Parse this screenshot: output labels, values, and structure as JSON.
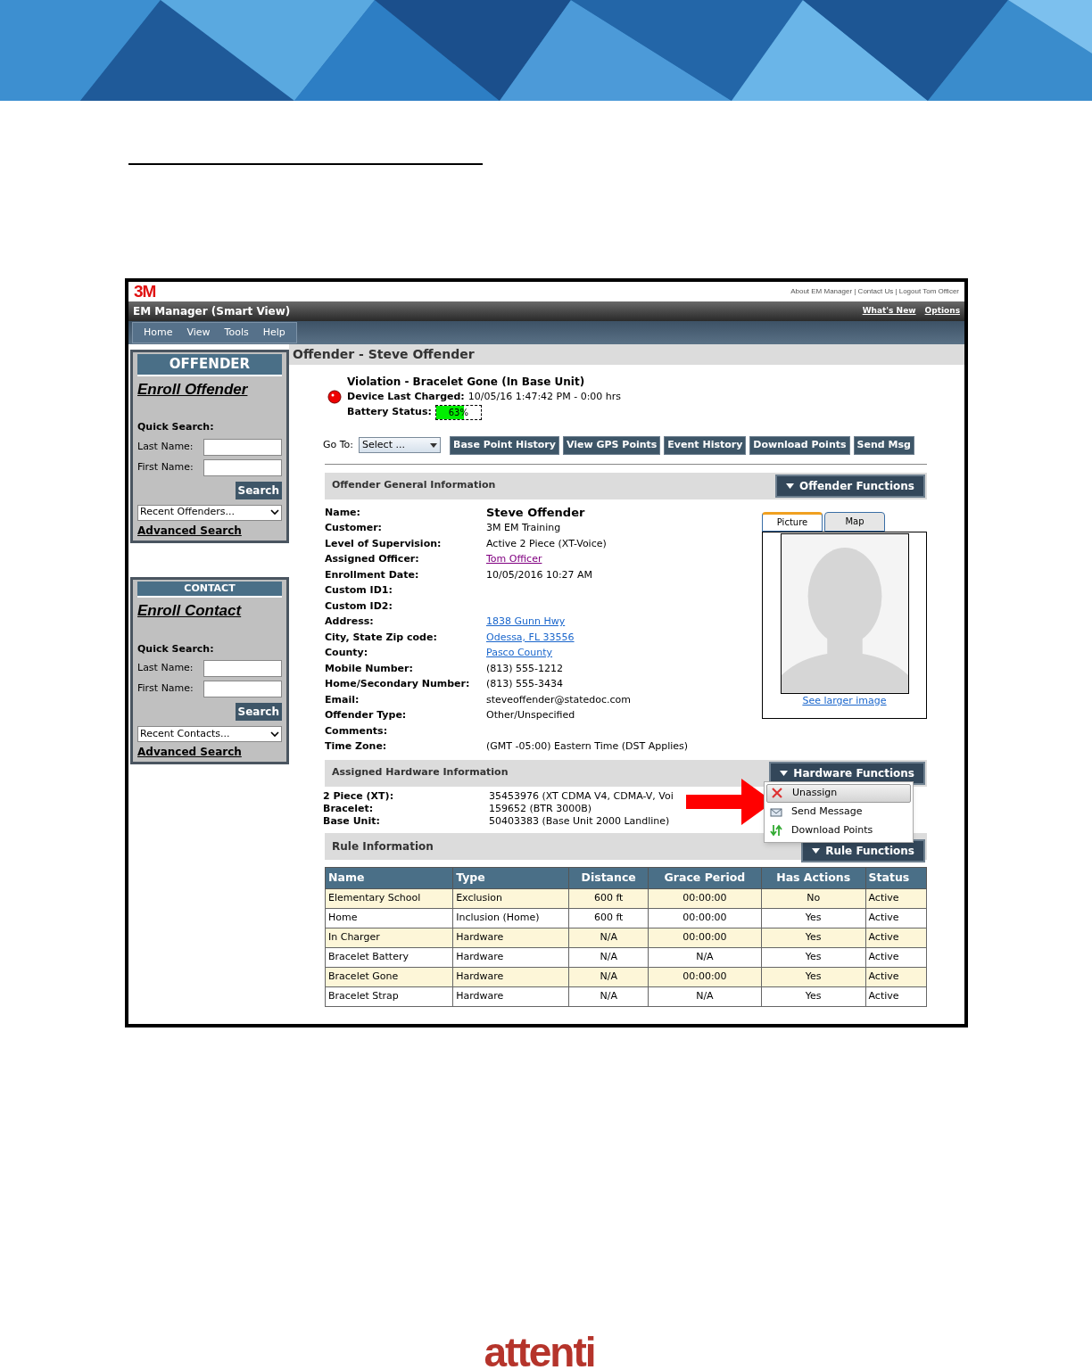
{
  "header": {
    "logo": "3M",
    "links": "About EM Manager | Contact Us | Logout Tom Officer"
  },
  "title_bar": {
    "title": "EM Manager (Smart View)",
    "links": [
      "What's New",
      "Options"
    ]
  },
  "menu": [
    "Home",
    "View",
    "Tools",
    "Help"
  ],
  "sidebar_panels": [
    {
      "title": "OFFENDER",
      "enroll": "Enroll Offender",
      "quick_search": "Quick Search:",
      "fields": [
        "Last Name:",
        "First Name:"
      ],
      "search_button": "Search",
      "recent": "Recent Offenders...",
      "advanced": "Advanced Search"
    },
    {
      "title": "CONTACT",
      "enroll": "Enroll Contact",
      "quick_search": "Quick Search:",
      "fields": [
        "Last Name:",
        "First Name:"
      ],
      "search_button": "Search",
      "recent": "Recent Contacts...",
      "advanced": "Advanced Search"
    }
  ],
  "page_title": "Offender - Steve Offender",
  "alert": {
    "violation": "Violation - Bracelet Gone (In Base Unit)",
    "charged_label": "Device Last Charged:",
    "charged_value": "10/05/16 1:47:42 PM - 0:00 hrs",
    "battery_label": "Battery Status:",
    "battery": {
      "level": 0.63,
      "reading": "63%"
    }
  },
  "goto": {
    "label": "Go To:",
    "select": "Select ..."
  },
  "actions": [
    "Base Point History",
    "View GPS Points",
    "Event History",
    "Download Points",
    "Send Msg"
  ],
  "general": {
    "title": "Offender General Information",
    "functions": "Offender Functions",
    "fields": [
      {
        "label": "Name:",
        "value": "Steve Offender",
        "kind": "heading"
      },
      {
        "label": "Customer:",
        "value": "3M EM Training",
        "kind": "text"
      },
      {
        "label": "Level of Supervision:",
        "value": "Active 2 Piece (XT-Voice)",
        "kind": "text"
      },
      {
        "label": "Assigned Officer:",
        "value": "Tom Officer",
        "kind": "visited"
      },
      {
        "label": "Enrollment Date:",
        "value": "10/05/2016 10:27 AM",
        "kind": "text"
      },
      {
        "label": "Custom ID1:"
      },
      {
        "label": "Custom ID2:"
      },
      {
        "label": "Address:",
        "value": "1838 Gunn Hwy",
        "kind": "link"
      },
      {
        "label": "City, State Zip code:",
        "value": "Odessa, FL 33556",
        "kind": "link"
      },
      {
        "label": "County:",
        "value": "Pasco County",
        "kind": "link"
      },
      {
        "label": "Mobile Number:",
        "value": "(813) 555-1212",
        "kind": "text"
      },
      {
        "label": "Home/Secondary Number:",
        "value": "(813) 555-3434",
        "kind": "text"
      },
      {
        "label": "Email:",
        "value": "steveoffender@statedoc.com",
        "kind": "text"
      },
      {
        "label": "Offender Type:",
        "value": "Other/Unspecified",
        "kind": "text"
      },
      {
        "label": "Comments:"
      },
      {
        "label": "Time Zone:",
        "value": "(GMT -05:00) Eastern Time (DST Applies)",
        "kind": "text"
      }
    ]
  },
  "photo_tabs": [
    {
      "label": "Picture",
      "selected": true
    },
    {
      "label": "Map",
      "selected": false
    }
  ],
  "see_larger": "See larger image",
  "hardware": {
    "title": "Assigned Hardware Information",
    "functions": "Hardware Functions",
    "rows": [
      {
        "label": "2 Piece (XT):",
        "value": "35453976 (XT CDMA V4, CDMA-V, Voi"
      },
      {
        "label": "Bracelet:",
        "value": "159652 (BTR 3000B)"
      },
      {
        "label": "Base Unit:",
        "value": "50403383 (Base Unit 2000 Landline)"
      }
    ],
    "menu": [
      {
        "label": "Unassign",
        "kind": "unassign",
        "selected": true
      },
      {
        "label": "Send Message",
        "kind": "message",
        "selected": false
      },
      {
        "label": "Download Points",
        "kind": "download",
        "selected": false
      }
    ]
  },
  "rules": {
    "title": "Rule Information",
    "functions": "Rule Functions",
    "columns": [
      "Name",
      "Type",
      "Distance",
      "Grace Period",
      "Has Actions",
      "Status"
    ],
    "rows": [
      [
        "Elementary School",
        "Exclusion",
        "600 ft",
        "00:00:00",
        "No",
        "Active"
      ],
      [
        "Home",
        "Inclusion (Home)",
        "600 ft",
        "00:00:00",
        "Yes",
        "Active"
      ],
      [
        "In Charger",
        "Hardware",
        "N/A",
        "00:00:00",
        "Yes",
        "Active"
      ],
      [
        "Bracelet Battery",
        "Hardware",
        "N/A",
        "N/A",
        "Yes",
        "Active"
      ],
      [
        "Bracelet Gone",
        "Hardware",
        "N/A",
        "00:00:00",
        "Yes",
        "Active"
      ],
      [
        "Bracelet Strap",
        "Hardware",
        "N/A",
        "N/A",
        "Yes",
        "Active"
      ]
    ]
  },
  "footer_logo": "attenti"
}
